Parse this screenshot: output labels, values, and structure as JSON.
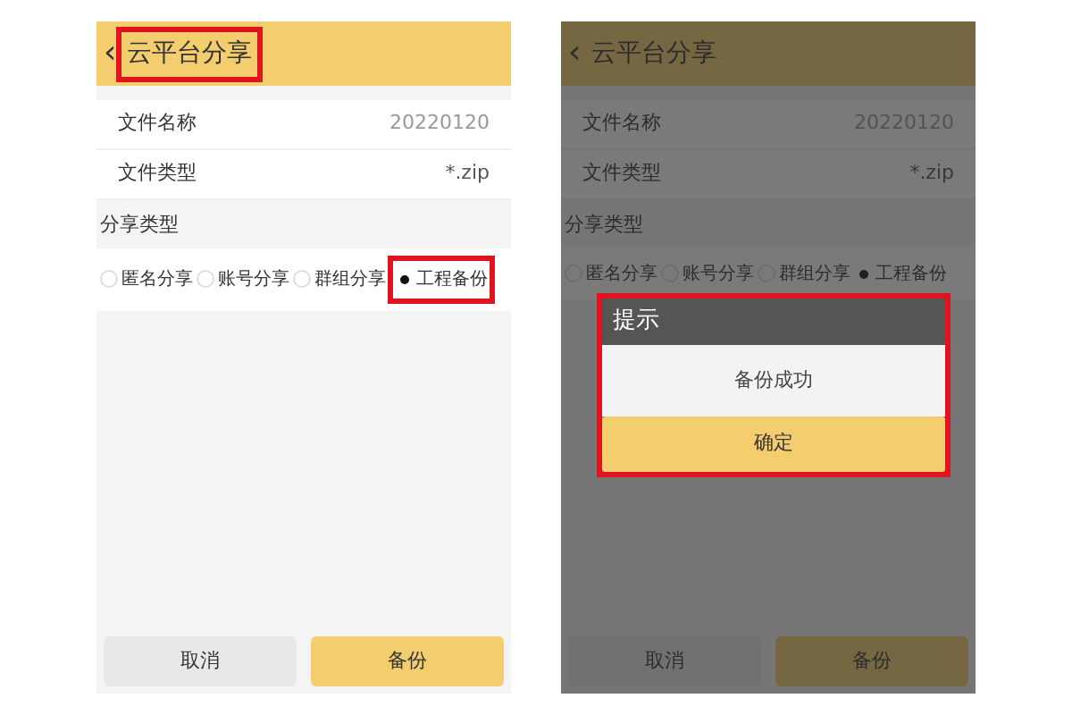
{
  "screens": [
    {
      "header": {
        "back": "‹",
        "title": "云平台分享",
        "highlighted": true
      },
      "fields": [
        {
          "label": "文件名称",
          "value": "20220120"
        },
        {
          "label": "文件类型",
          "value": "*.zip"
        }
      ],
      "share_type": {
        "label": "分享类型",
        "options": [
          {
            "label": "匿名分享",
            "selected": false,
            "highlighted": false
          },
          {
            "label": "账号分享",
            "selected": false,
            "highlighted": false
          },
          {
            "label": "群组分享",
            "selected": false,
            "highlighted": false
          },
          {
            "label": "工程备份",
            "selected": true,
            "highlighted": true
          }
        ]
      },
      "buttons": [
        {
          "label": "取消",
          "kind": "secondary"
        },
        {
          "label": "备份",
          "kind": "primary"
        }
      ]
    },
    {
      "header": {
        "back": "‹",
        "title": "云平台分享",
        "highlighted": false
      },
      "fields": [
        {
          "label": "文件名称",
          "value": "20220120"
        },
        {
          "label": "文件类型",
          "value": "*.zip"
        }
      ],
      "share_type": {
        "label": "分享类型",
        "options": [
          {
            "label": "匿名分享",
            "selected": false,
            "highlighted": false
          },
          {
            "label": "账号分享",
            "selected": false,
            "highlighted": false
          },
          {
            "label": "群组分享",
            "selected": false,
            "highlighted": false
          },
          {
            "label": "工程备份",
            "selected": true,
            "highlighted": false
          }
        ]
      },
      "buttons": [
        {
          "label": "取消",
          "kind": "secondary"
        },
        {
          "label": "备份",
          "kind": "primary"
        }
      ],
      "dialog": {
        "title": "提示",
        "message": "备份成功",
        "button": "确定",
        "highlighted": true
      }
    }
  ]
}
